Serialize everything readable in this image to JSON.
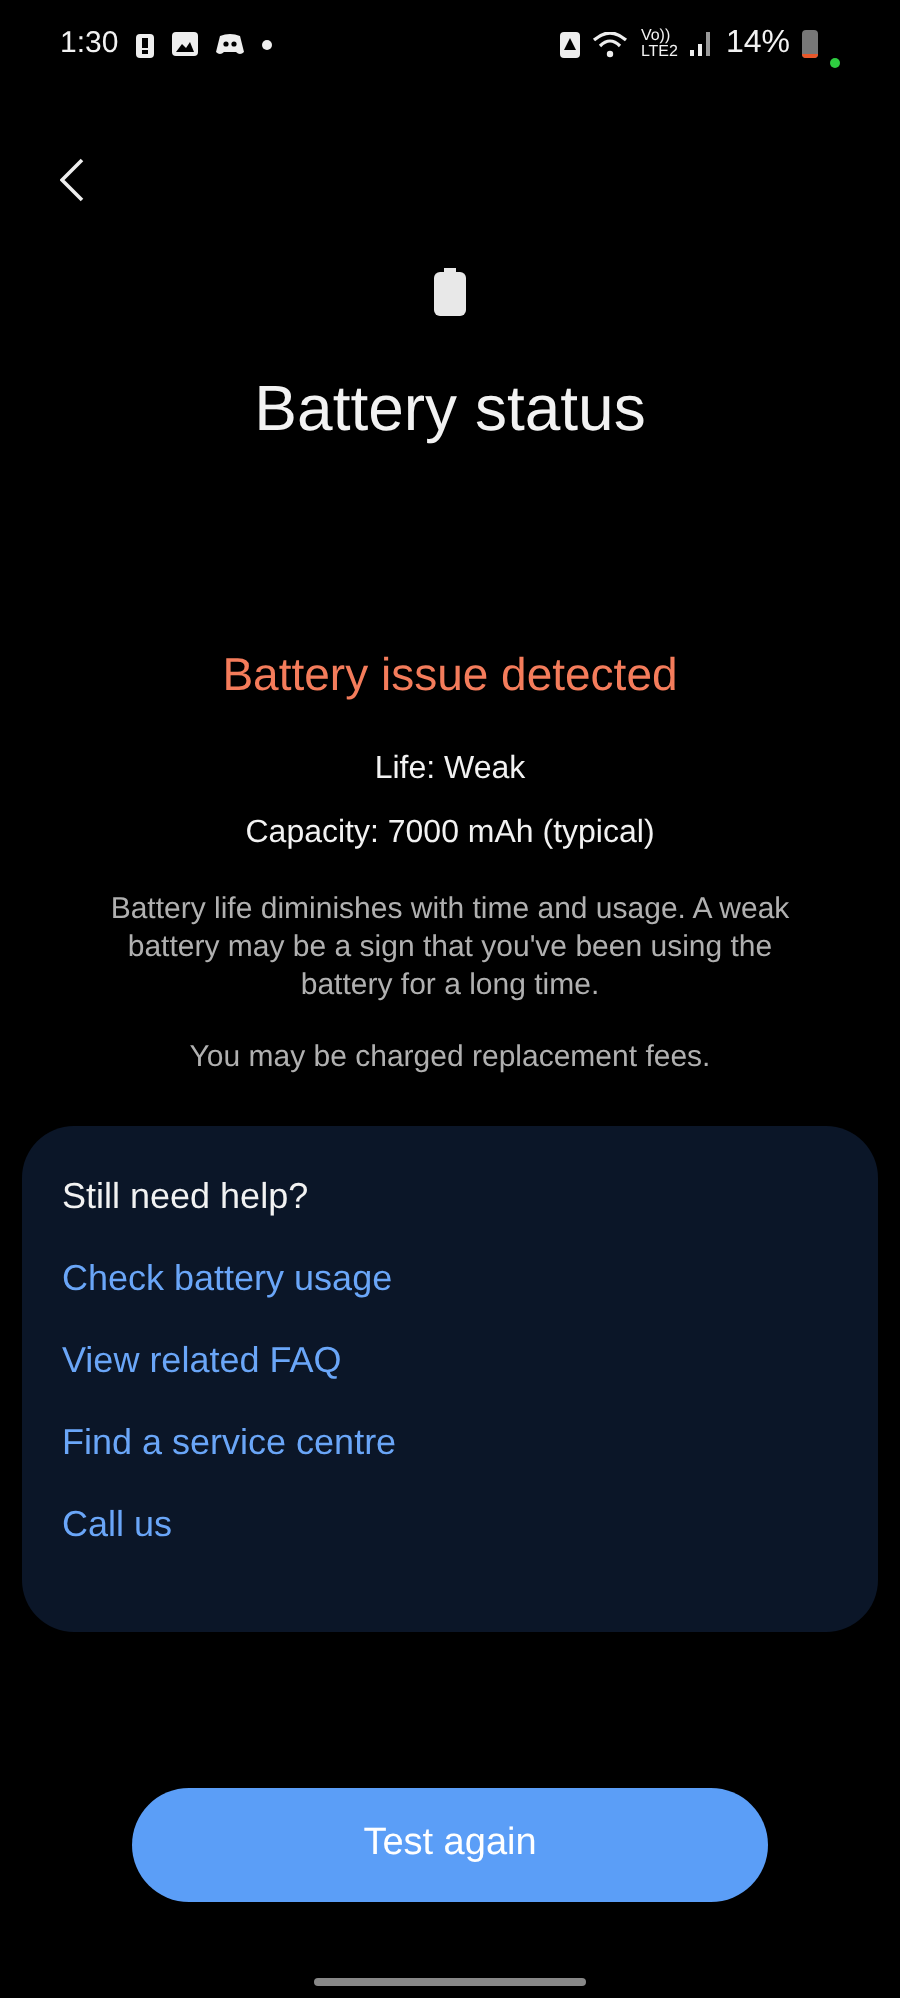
{
  "status_bar": {
    "time": "1:30",
    "network_top": "Vo))",
    "network_bottom": "LTE2",
    "battery_percent": "14%"
  },
  "title": "Battery status",
  "status_message": "Battery issue detected",
  "details": [
    "Life: Weak",
    "Capacity: 7000 mAh (typical)"
  ],
  "description": "Battery life diminishes with time and usage. A weak battery may be a sign that you've been using the battery for a long time.",
  "note": "You may be charged replacement fees.",
  "help_card": {
    "title": "Still need help?",
    "links": [
      "Check battery usage",
      "View related FAQ",
      "Find a service centre",
      "Call us"
    ]
  },
  "primary_button": "Test again"
}
